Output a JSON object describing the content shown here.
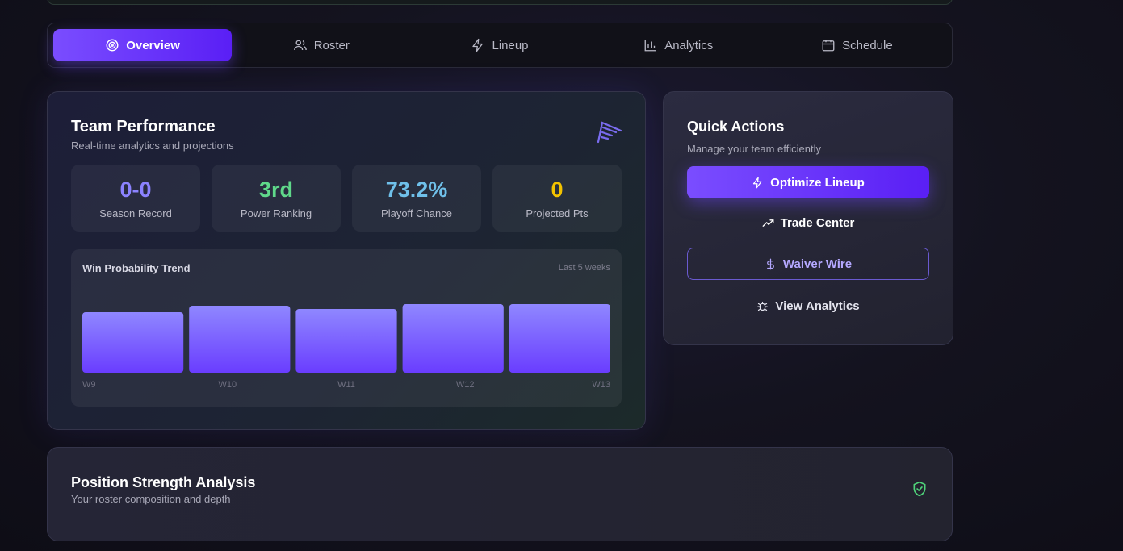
{
  "tabs": [
    {
      "label": "Overview",
      "icon": "target-icon",
      "active": true
    },
    {
      "label": "Roster",
      "icon": "users-icon",
      "active": false
    },
    {
      "label": "Lineup",
      "icon": "bolt-icon",
      "active": false
    },
    {
      "label": "Analytics",
      "icon": "bar-chart-icon",
      "active": false
    },
    {
      "label": "Schedule",
      "icon": "calendar-icon",
      "active": false
    }
  ],
  "performance": {
    "title": "Team Performance",
    "subtitle": "Real-time analytics and projections",
    "stats": [
      {
        "value": "0-0",
        "label": "Season Record",
        "color": "#8b82ff"
      },
      {
        "value": "3rd",
        "label": "Power Ranking",
        "color": "#5fd88a"
      },
      {
        "value": "73.2%",
        "label": "Playoff Chance",
        "color": "#6fc0ea"
      },
      {
        "value": "0",
        "label": "Projected Pts",
        "color": "#f2c200"
      }
    ],
    "trend": {
      "title": "Win Probability Trend",
      "range_label": "Last 5 weeks"
    }
  },
  "chart_data": {
    "type": "bar",
    "categories": [
      "W9",
      "W10",
      "W11",
      "W12",
      "W13"
    ],
    "values": [
      75,
      83,
      79,
      85,
      85
    ],
    "ylim": [
      0,
      100
    ]
  },
  "quick_actions": {
    "title": "Quick Actions",
    "subtitle": "Manage your team efficiently",
    "optimize_label": "Optimize Lineup",
    "trade_label": "Trade Center",
    "waiver_label": "Waiver Wire",
    "analytics_label": "View Analytics"
  },
  "position": {
    "title": "Position Strength Analysis",
    "subtitle": "Your roster composition and depth"
  },
  "colors": {
    "accent": "#6a35ff",
    "shield": "#4fd37a"
  }
}
